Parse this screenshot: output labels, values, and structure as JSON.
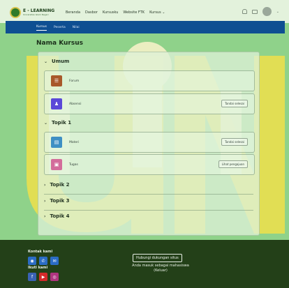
{
  "brand": {
    "title": "E - LEARNING",
    "subtitle": "Universitas Islam Negeri"
  },
  "nav": {
    "items": [
      "Beranda",
      "Dasbor",
      "Kursusku",
      "Website FTK",
      "Kursus"
    ]
  },
  "tabs": [
    "Kursus",
    "Peserta",
    "Nilai"
  ],
  "course": {
    "title": "Nama Kursus"
  },
  "sections": [
    {
      "name": "Umum",
      "activities": [
        {
          "label": "Forum",
          "icon": "forum-icon",
          "color": "#a8582a"
        },
        {
          "label": "Absensi",
          "icon": "attendance-icon",
          "color": "#5b48d8",
          "button": "Tandai selesai"
        }
      ]
    },
    {
      "name": "Topik 1",
      "activities": [
        {
          "label": "Materi",
          "icon": "file-icon",
          "color": "#3f8fc4",
          "button": "Tandai selesai"
        },
        {
          "label": "Tugas",
          "icon": "assignment-icon",
          "color": "#d36d9b",
          "button": "Lihat pengajuan"
        }
      ]
    },
    {
      "name": "Topik 2",
      "activities": []
    },
    {
      "name": "Topik 3",
      "activities": []
    },
    {
      "name": "Topik 4",
      "activities": []
    }
  ],
  "footer": {
    "contact_label": "Kontak kami",
    "follow_label": "Ikuti kami",
    "support_label": "Hubungi dukungan situs",
    "login_line1": "Anda masuk sebagai mahasiswa",
    "login_line2": "(Keluar)"
  },
  "colors": {
    "course_header": "#0e4f92",
    "footer": "#234018",
    "watermark": "#f0e14a",
    "page": "#8fd28a"
  }
}
